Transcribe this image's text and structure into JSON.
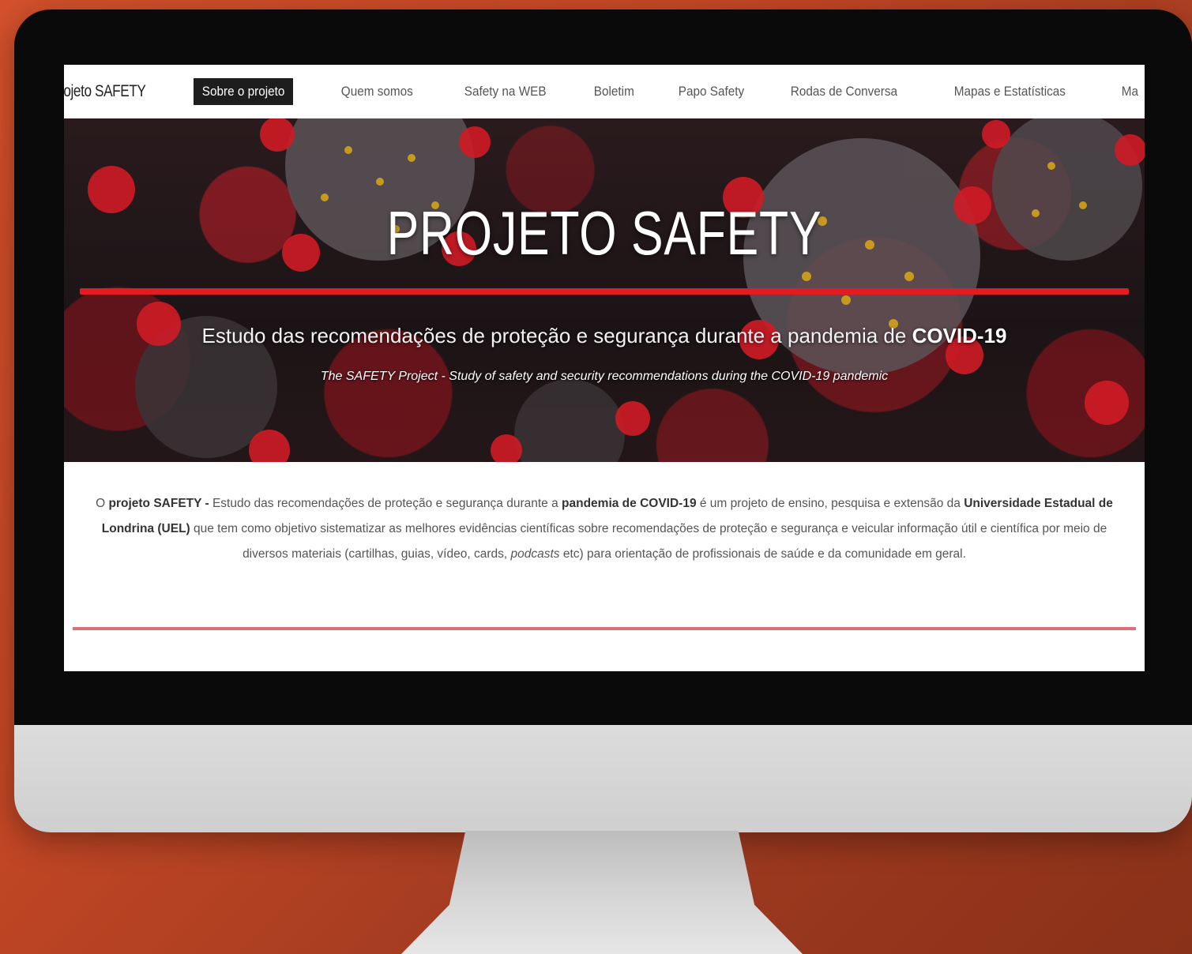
{
  "nav": {
    "brand": "rojeto SAFETY",
    "items": [
      {
        "label": "Sobre o projeto",
        "active": true
      },
      {
        "label": "Quem somos"
      },
      {
        "label": "Safety na WEB"
      },
      {
        "label": "Boletim"
      },
      {
        "label": "Papo Safety"
      },
      {
        "label": "Rodas de Conversa"
      },
      {
        "label": "Mapas e Estatísticas"
      },
      {
        "label": "Ma"
      }
    ]
  },
  "hero": {
    "title": "PROJETO SAFETY",
    "subtitle_pre": "Estudo das recomendações de proteção e segurança durante a pandemia de",
    "subtitle_bold": "COVID-19",
    "english": "The SAFETY Project - Study of safety and security recommendations during the COVID-19 pandemic"
  },
  "intro": {
    "p1": "O ",
    "b1": "projeto SAFETY -",
    "p2": " Estudo das recomendações de proteção e segurança durante a ",
    "b2": "pandemia de COVID-19",
    "p3": " é um projeto de ensino, pesquisa e extensão da ",
    "b3": "Universidade Estadual de Londrina (UEL)",
    "p4": " que tem como objetivo sistematizar as melhores evidências científicas sobre recomendações de proteção e segurança e veicular informação útil e científica por meio de diversos materiais (cartilhas, guias, vídeo, cards, ",
    "i1": "podcasts",
    "p5": " etc) para orientação de profissionais de saúde e da comunidade em geral."
  },
  "colors": {
    "accent_red": "#e31b23",
    "background_orange": "#c64826",
    "nav_active_bg": "#1d1d1d"
  }
}
